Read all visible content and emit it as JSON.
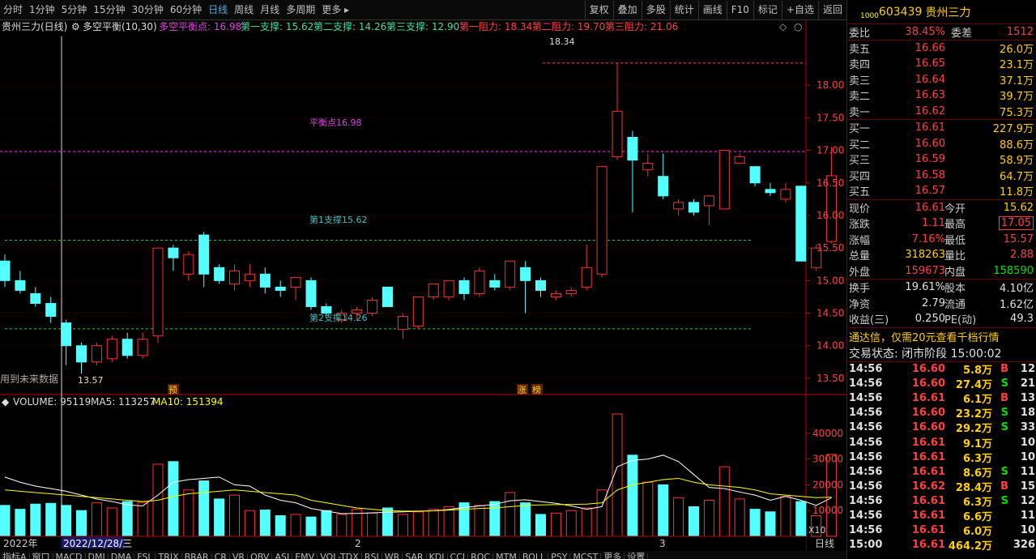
{
  "toolbar": {
    "periods": [
      "分时",
      "1分钟",
      "5分钟",
      "15分钟",
      "30分钟",
      "60分钟",
      "日线",
      "周线",
      "月线",
      "多周期",
      "更多 ▸"
    ],
    "active_period": "日线",
    "right_buttons": [
      "复权",
      "叠加",
      "多股",
      "统计",
      "画线",
      "F10",
      "标记",
      "+自选",
      "返回"
    ]
  },
  "indicator_header": {
    "stock": "贵州三力(日线)",
    "indicator": "多空平衡(10,30)",
    "balance": "多空平衡点: 16.98",
    "s1": "第一支撑: 15.62",
    "s2": "第二支撑: 14.26",
    "s3": "第三支撑: 12.90",
    "r1": "第一阻力: 18.34",
    "r2": "第二阻力: 19.70",
    "r3": "第三阻力: 21.06"
  },
  "chart_labels": {
    "balance_label": "平衡点16.98",
    "support1_label": "第1支撑15.62",
    "support2_label": "第2支撑14.26",
    "high_label": "18.34",
    "low_label": "13.57",
    "future_label": "用到未来数据",
    "mark_yu": "预",
    "mark_zhang": "涨",
    "mark_bang": "榜",
    "volume_header": "VOLUME: 95119",
    "ma5_header": "MA5: 113257",
    "ma10_header": "MA10: 151394",
    "x10": "X10",
    "year_label": "2022年",
    "date_label": "2022/12/28/三",
    "month2": "2",
    "month3": "3",
    "period_label": "日线"
  },
  "chart_data": {
    "type": "candlestick",
    "price_axis": {
      "ticks": [
        "18.00",
        "17.50",
        "17.00",
        "16.50",
        "16.00",
        "15.50",
        "15.00",
        "14.50",
        "14.00",
        "13.50"
      ],
      "min": 13.3,
      "max": 18.5
    },
    "volume_axis": {
      "ticks": [
        "40000",
        "30000",
        "20000",
        "10000"
      ],
      "max": 50000
    },
    "levels": {
      "balance": 16.98,
      "support1": 15.62,
      "support2": 14.26,
      "resistance1": 18.34
    },
    "candles": [
      [
        15.3,
        15.4,
        14.9,
        15.0
      ],
      [
        15.0,
        15.15,
        14.8,
        14.85
      ],
      [
        14.8,
        14.9,
        14.6,
        14.65
      ],
      [
        14.65,
        14.75,
        14.35,
        14.45
      ],
      [
        14.35,
        14.4,
        13.7,
        14.0
      ],
      [
        14.0,
        14.05,
        13.57,
        13.75
      ],
      [
        13.75,
        14.05,
        13.7,
        14.0
      ],
      [
        13.8,
        14.15,
        13.75,
        14.1
      ],
      [
        14.1,
        14.2,
        13.8,
        13.85
      ],
      [
        13.85,
        14.2,
        13.8,
        14.1
      ],
      [
        14.15,
        15.5,
        14.05,
        15.5
      ],
      [
        15.5,
        15.55,
        15.15,
        15.35
      ],
      [
        15.1,
        15.45,
        15.0,
        15.4
      ],
      [
        15.7,
        15.75,
        14.9,
        15.1
      ],
      [
        15.2,
        15.25,
        14.95,
        15.0
      ],
      [
        14.95,
        15.25,
        14.85,
        15.15
      ],
      [
        15.0,
        15.25,
        14.9,
        15.1
      ],
      [
        15.1,
        15.2,
        14.8,
        14.9
      ],
      [
        14.9,
        15.0,
        14.75,
        14.85
      ],
      [
        14.9,
        15.05,
        14.7,
        15.05
      ],
      [
        15.0,
        15.05,
        14.55,
        14.6
      ],
      [
        14.6,
        14.65,
        14.45,
        14.5
      ],
      [
        14.4,
        14.55,
        14.35,
        14.5
      ],
      [
        14.5,
        14.6,
        14.4,
        14.55
      ],
      [
        14.5,
        14.75,
        14.45,
        14.7
      ],
      [
        14.9,
        14.9,
        14.6,
        14.6
      ],
      [
        14.25,
        14.5,
        14.1,
        14.45
      ],
      [
        14.3,
        14.75,
        14.25,
        14.75
      ],
      [
        14.75,
        14.95,
        14.7,
        14.95
      ],
      [
        14.75,
        15.0,
        14.7,
        15.0
      ],
      [
        15.0,
        15.05,
        14.7,
        14.8
      ],
      [
        14.8,
        15.2,
        14.75,
        15.15
      ],
      [
        15.0,
        15.1,
        14.85,
        14.9
      ],
      [
        14.9,
        15.3,
        14.85,
        15.3
      ],
      [
        15.2,
        15.3,
        14.5,
        15.0
      ],
      [
        15.0,
        15.05,
        14.75,
        14.85
      ],
      [
        14.75,
        14.85,
        14.7,
        14.8
      ],
      [
        14.8,
        14.9,
        14.75,
        14.85
      ],
      [
        14.9,
        15.55,
        14.85,
        15.2
      ],
      [
        15.1,
        16.75,
        15.05,
        16.75
      ],
      [
        16.9,
        18.34,
        16.85,
        17.6
      ],
      [
        17.2,
        17.3,
        16.05,
        16.85
      ],
      [
        16.7,
        16.95,
        16.6,
        16.8
      ],
      [
        16.6,
        16.95,
        16.25,
        16.3
      ],
      [
        16.1,
        16.25,
        16.0,
        16.2
      ],
      [
        16.2,
        16.25,
        16.0,
        16.05
      ],
      [
        16.15,
        16.3,
        15.85,
        16.3
      ],
      [
        16.1,
        17.0,
        16.1,
        17.0
      ],
      [
        16.8,
        16.95,
        16.8,
        16.9
      ],
      [
        16.75,
        16.75,
        16.45,
        16.5
      ],
      [
        16.4,
        16.5,
        16.3,
        16.35
      ],
      [
        16.25,
        16.5,
        16.2,
        16.4
      ],
      [
        16.45,
        16.45,
        15.3,
        15.3
      ],
      [
        15.2,
        15.55,
        15.15,
        15.5
      ],
      [
        15.6,
        17.05,
        15.57,
        16.61
      ]
    ],
    "volumes": [
      12000,
      10500,
      12500,
      12800,
      12000,
      10000,
      13000,
      11000,
      13500,
      13200,
      28000,
      29000,
      18000,
      21500,
      14500,
      16000,
      10000,
      10200,
      8000,
      8500,
      7500,
      10000,
      8500,
      10500,
      9000,
      11000,
      8500,
      9500,
      10500,
      11500,
      13000,
      12000,
      13500,
      17000,
      13000,
      8500,
      9000,
      10000,
      11000,
      18000,
      47500,
      31500,
      21000,
      20000,
      15000,
      11500,
      14000,
      27000,
      14500,
      10500,
      9500,
      15500,
      13500,
      8000,
      31800
    ],
    "ma5": [
      23000,
      21000,
      19500,
      18500,
      17500,
      16000,
      14500,
      13500,
      12200,
      11800,
      16000,
      21000,
      22000,
      22500,
      23000,
      20000,
      19500,
      16000,
      14000,
      13000,
      10800,
      9800,
      8800,
      8900,
      9100,
      9300,
      9500,
      9700,
      9900,
      10400,
      11200,
      11800,
      12400,
      13800,
      14200,
      13500,
      12800,
      11800,
      10500,
      11500,
      27000,
      29500,
      30000,
      31500,
      29000,
      24000,
      19000,
      18500,
      17200,
      16000,
      14000,
      15500,
      14000,
      12000,
      15000
    ],
    "ma10": [
      18000,
      17500,
      17000,
      16500,
      16000,
      15500,
      15000,
      14500,
      14000,
      13500,
      14000,
      15500,
      16500,
      17000,
      17500,
      18000,
      17500,
      17000,
      16500,
      16000,
      14000,
      13000,
      12000,
      11000,
      10500,
      10000,
      9800,
      9800,
      9900,
      10200,
      10500,
      10800,
      11000,
      11500,
      12000,
      12200,
      12300,
      12400,
      12500,
      13000,
      18000,
      20000,
      21000,
      22000,
      22500,
      21000,
      20000,
      19500,
      19000,
      18000,
      16500,
      16000,
      15500,
      15000,
      15200
    ]
  },
  "panel": {
    "code": "603439",
    "name": "贵州三力",
    "weibi_label": "委比",
    "weibi": "38.45%",
    "weicha_label": "委差",
    "weicha": "1512",
    "asks": [
      {
        "label": "卖五",
        "price": "16.66",
        "vol": "26.0万"
      },
      {
        "label": "卖四",
        "price": "16.65",
        "vol": "23.1万"
      },
      {
        "label": "卖三",
        "price": "16.64",
        "vol": "37.1万"
      },
      {
        "label": "卖二",
        "price": "16.63",
        "vol": "39.7万"
      },
      {
        "label": "卖一",
        "price": "16.62",
        "vol": "75.3万"
      }
    ],
    "bids": [
      {
        "label": "买一",
        "price": "16.61",
        "vol": "227.9万"
      },
      {
        "label": "买二",
        "price": "16.60",
        "vol": "88.6万"
      },
      {
        "label": "买三",
        "price": "16.59",
        "vol": "58.9万"
      },
      {
        "label": "买四",
        "price": "16.58",
        "vol": "64.7万"
      },
      {
        "label": "买五",
        "price": "16.57",
        "vol": "11.8万"
      }
    ],
    "quote": [
      {
        "l1": "现价",
        "v1": "16.61",
        "l2": "今开",
        "v2": "15.62"
      },
      {
        "l1": "涨跌",
        "v1": "1.11",
        "l2": "最高",
        "v2": "17.05"
      },
      {
        "l1": "涨幅",
        "v1": "7.16%",
        "l2": "最低",
        "v2": "15.57"
      },
      {
        "l1": "总量",
        "v1": "318263",
        "l2": "量比",
        "v2": "2.88"
      },
      {
        "l1": "外盘",
        "v1": "159673",
        "l2": "内盘",
        "v2": "158590"
      }
    ],
    "fin": [
      {
        "l1": "换手",
        "v1": "19.61%",
        "l2": "股本",
        "v2": "4.10亿"
      },
      {
        "l1": "净资",
        "v1": "2.79",
        "l2": "流通",
        "v2": "1.62亿"
      },
      {
        "l1": "收益(三)",
        "v1": "0.250",
        "l2": "PE(动)",
        "v2": "49.3"
      }
    ],
    "ad": "通达信，仅需20元查看千档行情",
    "status": "交易状态: 闭市阶段 15:00:02",
    "ticks": [
      {
        "t": "14:56",
        "p": "16.60",
        "v": "5.8万",
        "s": "B",
        "n": "12"
      },
      {
        "t": "14:56",
        "p": "16.60",
        "v": "27.4万",
        "s": "S",
        "n": "21"
      },
      {
        "t": "14:56",
        "p": "16.61",
        "v": "6.1万",
        "s": "B",
        "n": "13"
      },
      {
        "t": "14:56",
        "p": "16.60",
        "v": "23.2万",
        "s": "S",
        "n": "18"
      },
      {
        "t": "14:56",
        "p": "16.60",
        "v": "29.2万",
        "s": "S",
        "n": "33"
      },
      {
        "t": "14:56",
        "p": "16.61",
        "v": "9.1万",
        "s": "",
        "n": "10"
      },
      {
        "t": "14:56",
        "p": "16.61",
        "v": "6.3万",
        "s": "",
        "n": "10"
      },
      {
        "t": "14:56",
        "p": "16.61",
        "v": "8.6万",
        "s": "S",
        "n": "11"
      },
      {
        "t": "14:56",
        "p": "16.62",
        "v": "28.4万",
        "s": "B",
        "n": "15"
      },
      {
        "t": "14:56",
        "p": "16.61",
        "v": "6.3万",
        "s": "S",
        "n": "12"
      },
      {
        "t": "14:56",
        "p": "16.61",
        "v": "6.6万",
        "s": "",
        "n": "11"
      },
      {
        "t": "14:56",
        "p": "16.61",
        "v": "6.0万",
        "s": "",
        "n": "10"
      },
      {
        "t": "15:00",
        "p": "16.61",
        "v": "464.2万",
        "s": "",
        "n": "326"
      }
    ]
  },
  "bottom_tabs": [
    "指标A",
    "窗口",
    "MACD",
    "DMI",
    "DMA",
    "FSL",
    "TRIX",
    "BRAR",
    "CR",
    "VR",
    "OBV",
    "ASI",
    "EMV",
    "VOL-TDX",
    "RSI",
    "WR",
    "SAR",
    "KDJ",
    "CCI",
    "ROC",
    "MTM",
    "BOLL",
    "PSY",
    "MCST",
    "更多",
    "设置"
  ]
}
